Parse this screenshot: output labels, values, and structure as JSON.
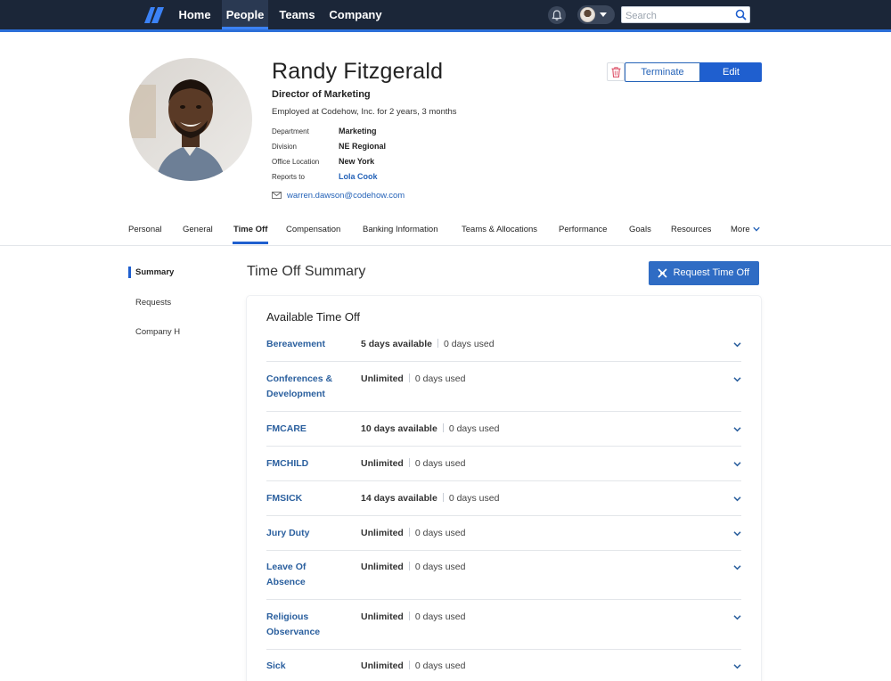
{
  "nav": {
    "items": [
      {
        "label": "Home",
        "active": false
      },
      {
        "label": "People",
        "active": true
      },
      {
        "label": "Teams",
        "active": false
      },
      {
        "label": "Company",
        "active": false
      }
    ],
    "search_placeholder": "Search",
    "icons": [
      "logo-icon",
      "bell-icon",
      "user-avatar",
      "chevron-down-icon",
      "search-icon"
    ]
  },
  "profile": {
    "name": "Randy Fitzgerald",
    "title": "Director of Marketing",
    "tenure": "Employed at Codehow, Inc. for 2 years, 3 months",
    "details": [
      {
        "label": "Department",
        "value": "Marketing",
        "link": false
      },
      {
        "label": "Division",
        "value": "NE Regional",
        "link": false
      },
      {
        "label": "Office Location",
        "value": "New York",
        "link": false
      },
      {
        "label": "Reports to",
        "value": "Lola Cook",
        "link": true
      }
    ],
    "email": "warren.dawson@codehow.com"
  },
  "actions": {
    "terminate_label": "Terminate",
    "edit_label": "Edit"
  },
  "tabs": [
    {
      "label": "Personal",
      "active": false
    },
    {
      "label": "General",
      "active": false
    },
    {
      "label": "Time Off",
      "active": true
    },
    {
      "label": "Compensation",
      "active": false
    },
    {
      "label": "Banking Information",
      "active": false
    },
    {
      "label": "Teams & Allocations",
      "active": false
    },
    {
      "label": "Performance",
      "active": false
    },
    {
      "label": "Goals",
      "active": false
    },
    {
      "label": "Resources",
      "active": false
    },
    {
      "label": "More",
      "active": false
    }
  ],
  "subnav": [
    {
      "label": "Summary",
      "active": true
    },
    {
      "label": "Requests",
      "active": false
    },
    {
      "label": "Company Holidays",
      "active": false
    }
  ],
  "summary": {
    "title": "Time Off Summary",
    "request_button": "Request Time Off",
    "card_title": "Available Time Off",
    "rows": [
      {
        "policy": "Bereavement",
        "available": "5 days available",
        "used": "0 days used"
      },
      {
        "policy": "Conferences & Development",
        "available": "Unlimited",
        "used": "0 days used"
      },
      {
        "policy": "FMCARE",
        "available": "10 days available",
        "used": "0 days used"
      },
      {
        "policy": "FMCHILD",
        "available": "Unlimited",
        "used": "0 days used"
      },
      {
        "policy": "FMSICK",
        "available": "14 days available",
        "used": "0 days used"
      },
      {
        "policy": "Jury Duty",
        "available": "Unlimited",
        "used": "0 days used"
      },
      {
        "policy": "Leave Of Absence",
        "available": "Unlimited",
        "used": "0 days used"
      },
      {
        "policy": "Religious Observance",
        "available": "Unlimited",
        "used": "0 days used"
      },
      {
        "policy": "Sick",
        "available": "Unlimited",
        "used": "0 days used"
      }
    ]
  },
  "colors": {
    "nav_bg": "#1b2638",
    "accent": "#1f5fcf",
    "link": "#2563b8",
    "danger": "#d9415a"
  }
}
